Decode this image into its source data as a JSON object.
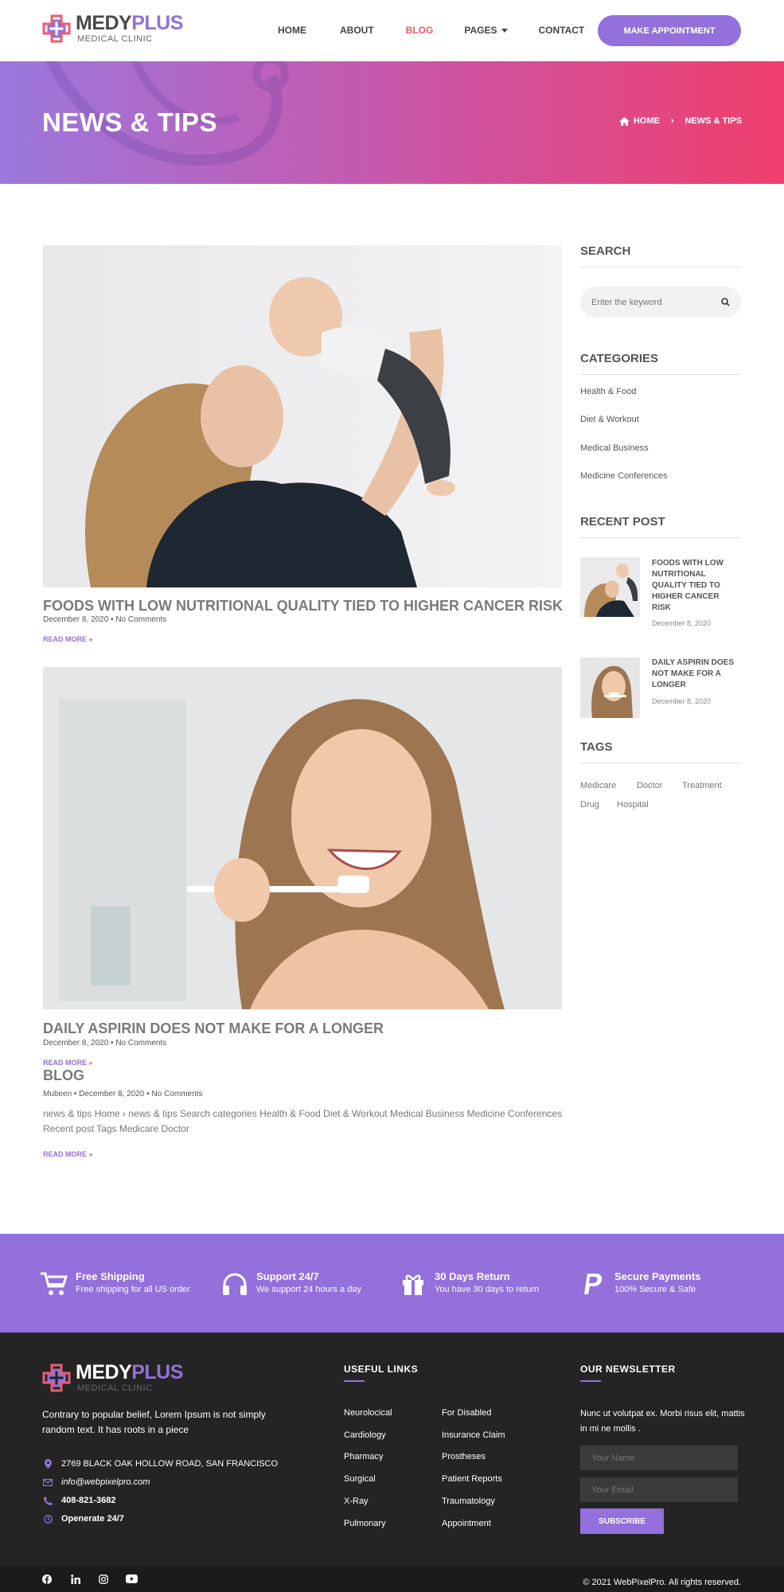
{
  "brand": {
    "name_part1": "MEDY",
    "name_part2": "PLUS",
    "subtitle": "MEDICAL CLINIC",
    "accent": "#9370db",
    "pink": "#ee5a6f"
  },
  "nav": {
    "items": [
      "HOME",
      "ABOUT",
      "BLOG",
      "PAGES",
      "CONTACT"
    ],
    "active": "BLOG",
    "cta": "MAKE APPOINTMENT"
  },
  "hero": {
    "title": "NEWS & TIPS",
    "breadcrumb_home": "HOME",
    "breadcrumb_current": "NEWS & TIPS"
  },
  "posts": [
    {
      "title": "FOODS WITH LOW NUTRITIONAL QUALITY TIED TO HIGHER CANCER RISK",
      "meta": "December 8, 2020 • No Comments",
      "read_more": "READ MORE »"
    },
    {
      "title": "DAILY ASPIRIN DOES NOT MAKE FOR A LONGER",
      "meta": "December 8, 2020 • No Comments",
      "read_more": "READ MORE »"
    }
  ],
  "blog": {
    "title": "BLOG",
    "meta": "Mubeen • December 8, 2020 • No Comments",
    "excerpt": "news & tips Home › news & tips Search categories Health & Food Diet & Workout Medical Business Medicine Conferences Recent post Tags Medicare Doctor",
    "read_more": "READ MORE »"
  },
  "sidebar": {
    "search_title": "SEARCH",
    "search_placeholder": "Enter the keyword",
    "categories_title": "CATEGORIES",
    "categories": [
      "Health & Food",
      "Diet & Workout",
      "Medical Business",
      "Medicine Conferences"
    ],
    "recent_title": "RECENT POST",
    "recent": [
      {
        "title": "FOODS WITH LOW NUTRITIONAL QUALITY TIED TO HIGHER CANCER RISK",
        "date": "December 8, 2020"
      },
      {
        "title": "DAILY ASPIRIN DOES NOT MAKE FOR A LONGER",
        "date": "December 8, 2020"
      }
    ],
    "tags_title": "TAGS",
    "tags": [
      "Medicare",
      "Doctor",
      "Treatment",
      "Drug",
      "Hospital"
    ]
  },
  "features": [
    {
      "icon": "cart-icon",
      "title": "Free Shipping",
      "text": "Free shipping for all US order"
    },
    {
      "icon": "headphones-icon",
      "title": "Support 24/7",
      "text": "We support 24 hours a day"
    },
    {
      "icon": "gift-icon",
      "title": "30 Days Return",
      "text": "You have 30 days to return"
    },
    {
      "icon": "paypal-icon",
      "title": "Secure Payments",
      "text": "100% Secure & Safe"
    }
  ],
  "footer": {
    "about": "Contrary to popular belief, Lorem Ipsum is not simply random text. It has roots in a piece",
    "address": "2769 BLACK OAK HOLLOW ROAD, SAN FRANCISCO",
    "email": "info@webpixelpro.com",
    "phone": "408-821-3682",
    "hours": "Openerate 24/7",
    "links_title": "USEFUL LINKS",
    "links_col1": [
      "Neurolocical",
      "Cardiology",
      "Pharmacy",
      "Surgical",
      "X-Ray",
      "Pulmonary"
    ],
    "links_col2": [
      "For Disabled",
      "Insurance Claim",
      "Prostheses",
      "Patient Reports",
      "Traumatology",
      "Appointment"
    ],
    "newsletter_title": "OUR NEWSLETTER",
    "newsletter_text": "Nunc ut volutpat ex. Morbi risus elit, mattis in mi ne mollis .",
    "name_placeholder": "Your Name",
    "email_placeholder": "Your Email",
    "subscribe": "SUBSCRIBE",
    "copyright": "© 2021 WebPixelPro. All rights reserved."
  }
}
